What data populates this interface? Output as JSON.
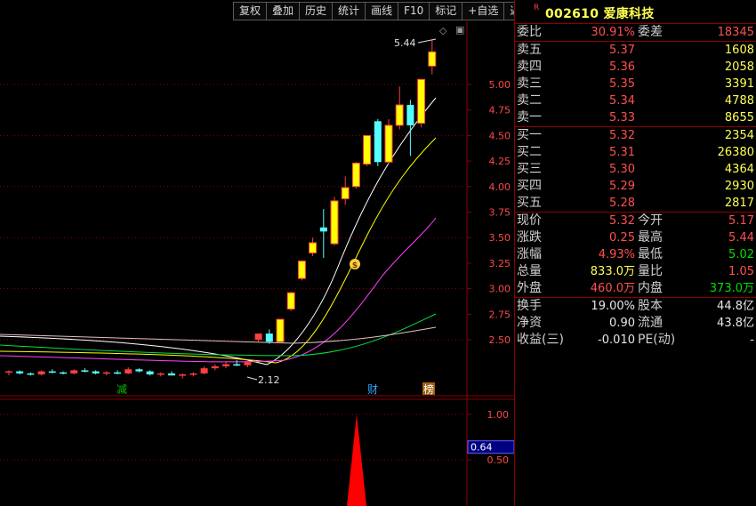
{
  "toolbar": {
    "buttons": [
      "复权",
      "叠加",
      "历史",
      "统计",
      "画线",
      "F10",
      "标记",
      "+自选",
      "返回"
    ]
  },
  "chart": {
    "price_axis_ticks": [
      "5.00",
      "4.75",
      "4.50",
      "4.25",
      "4.00",
      "3.75",
      "3.50",
      "3.25",
      "3.00",
      "2.75",
      "2.50"
    ],
    "high_label": "5.44",
    "low_label": "2.12",
    "event_tags": [
      "减",
      "财",
      "榜"
    ],
    "money_bag_icon": "money-bag-icon",
    "indicator_axis_ticks": [
      "1.00",
      "0.50"
    ],
    "indicator_current": "0.64"
  },
  "chart_data": {
    "type": "candlestick",
    "ohlc": [
      [
        2.18,
        2.2,
        2.15,
        2.19
      ],
      [
        2.19,
        2.2,
        2.16,
        2.17
      ],
      [
        2.17,
        2.18,
        2.15,
        2.16
      ],
      [
        2.16,
        2.2,
        2.15,
        2.19
      ],
      [
        2.19,
        2.21,
        2.17,
        2.18
      ],
      [
        2.18,
        2.19,
        2.16,
        2.17
      ],
      [
        2.17,
        2.21,
        2.16,
        2.2
      ],
      [
        2.2,
        2.22,
        2.18,
        2.19
      ],
      [
        2.19,
        2.2,
        2.16,
        2.17
      ],
      [
        2.17,
        2.19,
        2.15,
        2.18
      ],
      [
        2.18,
        2.2,
        2.16,
        2.17
      ],
      [
        2.17,
        2.23,
        2.16,
        2.21
      ],
      [
        2.21,
        2.22,
        2.18,
        2.19
      ],
      [
        2.19,
        2.2,
        2.15,
        2.16
      ],
      [
        2.16,
        2.18,
        2.14,
        2.17
      ],
      [
        2.17,
        2.19,
        2.15,
        2.15
      ],
      [
        2.15,
        2.17,
        2.12,
        2.16
      ],
      [
        2.16,
        2.18,
        2.14,
        2.17
      ],
      [
        2.17,
        2.24,
        2.16,
        2.22
      ],
      [
        2.22,
        2.26,
        2.2,
        2.24
      ],
      [
        2.24,
        2.28,
        2.22,
        2.26
      ],
      [
        2.26,
        2.3,
        2.24,
        2.25
      ],
      [
        2.25,
        2.3,
        2.23,
        2.28
      ],
      [
        2.5,
        2.56,
        2.48,
        2.56
      ],
      [
        2.56,
        2.6,
        2.46,
        2.48
      ],
      [
        2.48,
        2.7,
        2.47,
        2.7
      ],
      [
        2.8,
        2.97,
        2.78,
        2.96
      ],
      [
        3.1,
        3.28,
        3.08,
        3.27
      ],
      [
        3.35,
        3.5,
        3.32,
        3.45
      ],
      [
        3.6,
        3.78,
        3.3,
        3.56
      ],
      [
        3.44,
        3.9,
        3.42,
        3.86
      ],
      [
        3.88,
        4.1,
        3.82,
        3.99
      ],
      [
        4.0,
        4.24,
        3.98,
        4.23
      ],
      [
        4.22,
        4.4,
        4.2,
        4.5
      ],
      [
        4.64,
        4.66,
        4.2,
        4.24
      ],
      [
        4.24,
        4.66,
        4.22,
        4.6
      ],
      [
        4.6,
        4.98,
        4.56,
        4.8
      ],
      [
        4.8,
        4.85,
        4.3,
        4.6
      ],
      [
        4.62,
        5.0,
        4.58,
        5.05
      ],
      [
        5.18,
        5.44,
        5.1,
        5.32
      ]
    ],
    "ma_lines": [
      "white",
      "yellow",
      "magenta",
      "green"
    ],
    "indicator": {
      "current": 0.64,
      "peak": 1.0
    }
  },
  "quote": {
    "r_badge": "R",
    "code": "002610",
    "name": "爱康科技",
    "weibi_label": "委比",
    "weibi": "30.91%",
    "weicha_label": "委差",
    "weicha": "18345",
    "asks": [
      {
        "label": "卖五",
        "price": "5.37",
        "vol": "1608"
      },
      {
        "label": "卖四",
        "price": "5.36",
        "vol": "2058"
      },
      {
        "label": "卖三",
        "price": "5.35",
        "vol": "3391"
      },
      {
        "label": "卖二",
        "price": "5.34",
        "vol": "4788"
      },
      {
        "label": "卖一",
        "price": "5.33",
        "vol": "8655"
      }
    ],
    "bids": [
      {
        "label": "买一",
        "price": "5.32",
        "vol": "2354"
      },
      {
        "label": "买二",
        "price": "5.31",
        "vol": "26380"
      },
      {
        "label": "买三",
        "price": "5.30",
        "vol": "4364"
      },
      {
        "label": "买四",
        "price": "5.29",
        "vol": "2930"
      },
      {
        "label": "买五",
        "price": "5.28",
        "vol": "2817"
      }
    ],
    "stats": [
      {
        "l1": "现价",
        "v1": "5.32",
        "c1": "red",
        "l2": "今开",
        "v2": "5.17",
        "c2": "red"
      },
      {
        "l1": "涨跌",
        "v1": "0.25",
        "c1": "red",
        "l2": "最高",
        "v2": "5.44",
        "c2": "red"
      },
      {
        "l1": "涨幅",
        "v1": "4.93%",
        "c1": "red",
        "l2": "最低",
        "v2": "5.02",
        "c2": "green"
      },
      {
        "l1": "总量",
        "v1": "833.0万",
        "c1": "yellow",
        "l2": "量比",
        "v2": "1.05",
        "c2": "red"
      },
      {
        "l1": "外盘",
        "v1": "460.0万",
        "c1": "red",
        "l2": "内盘",
        "v2": "373.0万",
        "c2": "green"
      }
    ],
    "fin": [
      {
        "l1": "换手",
        "v1": "19.00%",
        "l2": "股本",
        "v2": "44.8亿"
      },
      {
        "l1": "净资",
        "v1": "0.90",
        "l2": "流通",
        "v2": "43.8亿"
      },
      {
        "l1": "收益(三)",
        "v1": "-0.010",
        "l2": "PE(动)",
        "v2": "-"
      }
    ]
  },
  "colors": {
    "up": "#ff4040",
    "up_fill": "#ffff00",
    "down": "#54ffff",
    "grid": "#8c0000"
  }
}
